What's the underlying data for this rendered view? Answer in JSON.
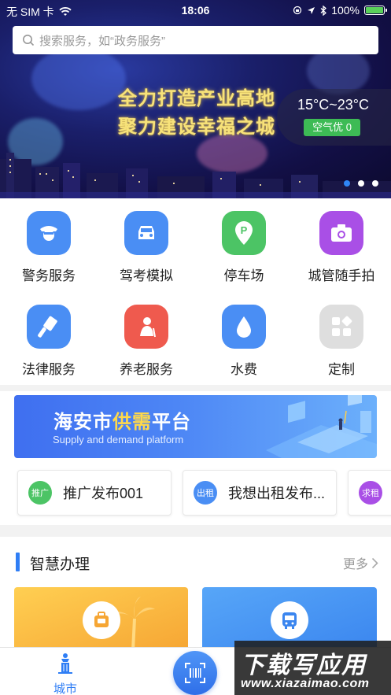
{
  "status_bar": {
    "carrier": "无 SIM 卡",
    "time": "18:06",
    "battery": "100%"
  },
  "search": {
    "placeholder": "搜索服务，如“政务服务”"
  },
  "banner": {
    "slogan_line1": "全力打造产业高地",
    "slogan_line2": "聚力建设幸福之城",
    "weather_temp": "15°C~23°C",
    "air_quality": "空气优 0",
    "active_slide": 1,
    "slide_count": 3
  },
  "services": [
    {
      "label": "警务服务",
      "icon": "police-icon",
      "color": "#4a8ef4"
    },
    {
      "label": "驾考模拟",
      "icon": "car-icon",
      "color": "#4a8ef4"
    },
    {
      "label": "停车场",
      "icon": "parking-icon",
      "color": "#4cc465"
    },
    {
      "label": "城管随手拍",
      "icon": "camera-icon",
      "color": "#a94fe6"
    },
    {
      "label": "法律服务",
      "icon": "gavel-icon",
      "color": "#4a8ef4"
    },
    {
      "label": "养老服务",
      "icon": "elder-icon",
      "color": "#ef5a4e"
    },
    {
      "label": "水费",
      "icon": "water-drop-icon",
      "color": "#4a8ef4"
    },
    {
      "label": "定制",
      "icon": "custom-grid-icon",
      "color": "#dedede"
    }
  ],
  "supply": {
    "title_prefix": "海安市",
    "title_highlight": "供需",
    "title_suffix": "平台",
    "subtitle": "Supply and demand platform"
  },
  "promos": [
    {
      "badge": "推广",
      "text": "推广发布001",
      "color": "#4cc465"
    },
    {
      "badge": "出租",
      "text": "我想出租发布...",
      "color": "#4a8ef4"
    },
    {
      "badge": "求租",
      "text": "",
      "color": "#a94fe6"
    }
  ],
  "section": {
    "title": "智慧办理",
    "more": "更多"
  },
  "tabbar": {
    "city_label": "城市"
  },
  "watermark": {
    "line1": "下载写应用",
    "line2": "www.xiazaimao.com"
  }
}
